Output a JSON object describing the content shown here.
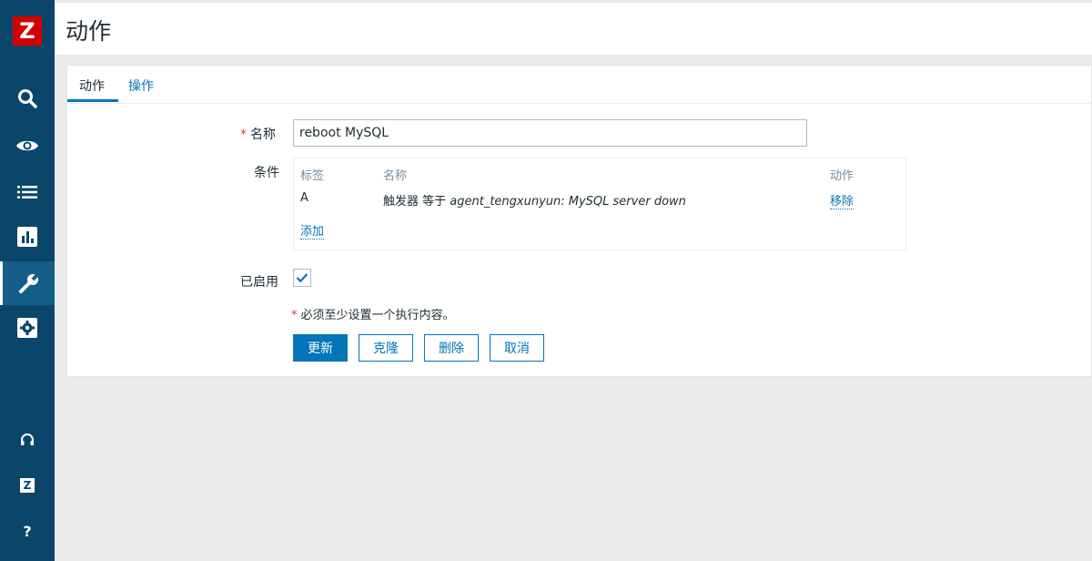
{
  "sidebar": {
    "logo_letter": "Z",
    "items": [
      {
        "name": "search",
        "icon": "search-icon"
      },
      {
        "name": "monitoring",
        "icon": "eye-icon"
      },
      {
        "name": "inventory",
        "icon": "list-icon"
      },
      {
        "name": "reports",
        "icon": "bar-chart-icon"
      },
      {
        "name": "configuration",
        "icon": "wrench-icon",
        "active": true
      },
      {
        "name": "administration",
        "icon": "gear-icon"
      }
    ],
    "bottom": {
      "support_icon": "headset-icon",
      "share_label": "Z",
      "help_label": "?"
    }
  },
  "header": {
    "title": "动作"
  },
  "tabs": [
    {
      "label": "动作",
      "active": true
    },
    {
      "label": "操作",
      "active": false
    }
  ],
  "form": {
    "required_mark": "*",
    "name_label": "名称",
    "name_value": "reboot MySQL",
    "conditions_label": "条件",
    "conditions": {
      "columns": [
        "标签",
        "名称",
        "动作"
      ],
      "rows": [
        {
          "tag": "A",
          "name_prefix": "触发器 等于 ",
          "name_value": "agent_tengxunyun: MySQL server down",
          "action": "移除"
        }
      ],
      "add_link": "添加"
    },
    "enabled_label": "已启用",
    "enabled": true,
    "note": "必须至少设置一个执行内容。"
  },
  "buttons": {
    "update": "更新",
    "clone": "克隆",
    "delete": "删除",
    "cancel": "取消"
  },
  "colors": {
    "sidebar_bg": "#0a466a",
    "accent": "#0275b8",
    "logo_red": "#d40000",
    "required_red": "#e33734"
  }
}
